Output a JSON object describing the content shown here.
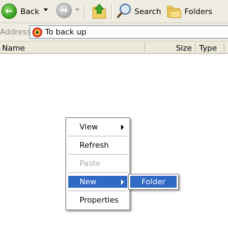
{
  "toolbar": {
    "back_label": "Back",
    "search_label": "Search",
    "folders_label": "Folders"
  },
  "address": {
    "label": "Address",
    "value": "To back up"
  },
  "columns": {
    "name": "Name",
    "size": "Size",
    "type": "Type"
  },
  "context_menu": {
    "items": [
      {
        "label": "View"
      },
      {
        "label": "Refresh"
      },
      {
        "label": "Paste"
      },
      {
        "label": "New"
      },
      {
        "label": "Properties"
      }
    ]
  },
  "submenu": {
    "items": [
      {
        "label": "Folder"
      }
    ]
  },
  "colors": {
    "chrome": "#efede2",
    "highlight": "#316ac5",
    "back_green": "#2f9a1e",
    "disabled_text": "#a8a8a8"
  }
}
